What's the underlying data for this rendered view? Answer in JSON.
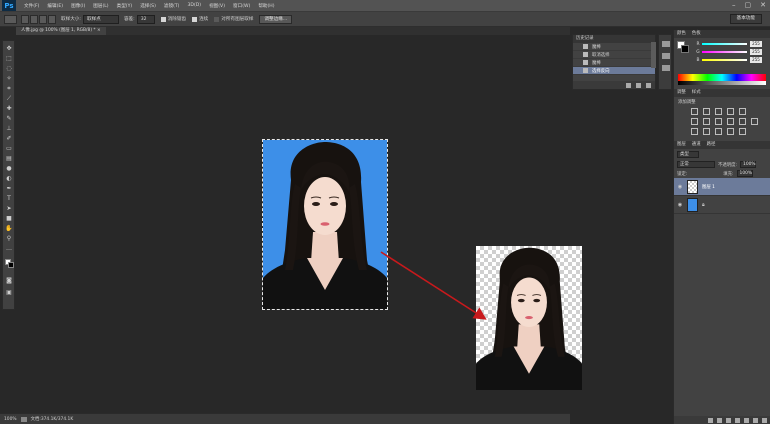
{
  "app": {
    "logo": "Ps",
    "menu": [
      "文件(F)",
      "编辑(E)",
      "图像(I)",
      "图层(L)",
      "类型(Y)",
      "选择(S)",
      "滤镜(T)",
      "3D(D)",
      "视图(V)",
      "窗口(W)",
      "帮助(H)"
    ],
    "window_controls": [
      "–",
      "▢",
      "✕"
    ]
  },
  "options": {
    "feather_label": "取样大小:",
    "sample_value": "取样点",
    "tolerance_label": "容差:",
    "tolerance_value": "32",
    "antialias_label": "消除锯齿",
    "contiguous_label": "连续",
    "all_layers_label": "对所有图层取样",
    "refine_button": "调整边缘...",
    "workspace": "基本功能"
  },
  "document": {
    "tab_title": "人像.jpg @ 100% (图层 1, RGB/8) * ×"
  },
  "status": {
    "zoom": "100%",
    "doc_info": "文档:374.1K/374.1K"
  },
  "history": {
    "tabs": [
      "历史记录"
    ],
    "items": [
      "魔棒",
      "取消选择",
      "魔棒",
      "选择反向"
    ]
  },
  "color_panel": {
    "tabs": [
      "颜色",
      "色板"
    ],
    "r": "255",
    "g": "255",
    "b": "255"
  },
  "adjustments": {
    "tabs": [
      "调整",
      "样式"
    ],
    "heading": "添加调整"
  },
  "layers": {
    "tabs": [
      "图层",
      "通道",
      "路径"
    ],
    "filter_kind": "类型",
    "blend_mode": "正常",
    "opacity_label": "不透明度:",
    "opacity_value": "100%",
    "lock_label": "锁定:",
    "fill_label": "填充:",
    "fill_value": "100%",
    "items": [
      {
        "name": "图层 1"
      },
      {
        "name": ""
      }
    ]
  },
  "colors": {
    "accent": "#6c7b9a",
    "photo_bg": "#3d8fe8",
    "arrow": "#c8191c"
  }
}
